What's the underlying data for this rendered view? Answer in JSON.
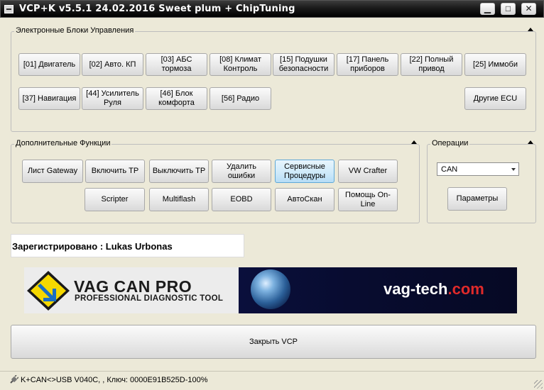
{
  "window": {
    "title": "VCP+K v5.5.1 24.02.2016 Sweet plum + ChipTuning",
    "minimize": "▁",
    "maximize": "□",
    "close": "✕"
  },
  "ecu_group": {
    "label": "Электронные Блоки Управления",
    "buttons": [
      "[01] Двигатель",
      "[02] Авто. КП",
      "[03] АБС тормоза",
      "[08] Климат Контроль",
      "[15] Подушки безопасности",
      "[17] Панель приборов",
      "[22] Полный привод",
      "[25] Иммоби",
      "[37] Навигация",
      "[44] Усилитель Руля",
      "[46] Блок комфорта",
      "[56] Радио",
      "Другие ECU"
    ]
  },
  "functions_group": {
    "label": "Дополнительные Функции",
    "buttons": [
      "Лист Gateway",
      "Включить ТР",
      "Выключить ТР",
      "Удалить ошибки",
      "Сервисные Процедуры",
      "VW Crafter",
      "Scripter",
      "Multiflash",
      "EOBD",
      "АвтоСкан",
      "Помощь On-Line"
    ]
  },
  "operations_group": {
    "label": "Операции",
    "protocol_selected": "CAN",
    "params_button": "Параметры"
  },
  "registered_text": "Зарегистрировано : Lukas Urbonas",
  "banner": {
    "brand": "VAG CAN PRO",
    "tagline": "PROFESSIONAL DIAGNOSTIC TOOL",
    "site_part1": "vag-tech",
    "site_part2": ".com",
    "logo_color": "#f5d800"
  },
  "close_button": "Закрыть VCP",
  "status": {
    "text": "K+CAN<>USB V040C, , Ключ: 0000E91B525D-100%",
    "icon": "plug-icon"
  }
}
